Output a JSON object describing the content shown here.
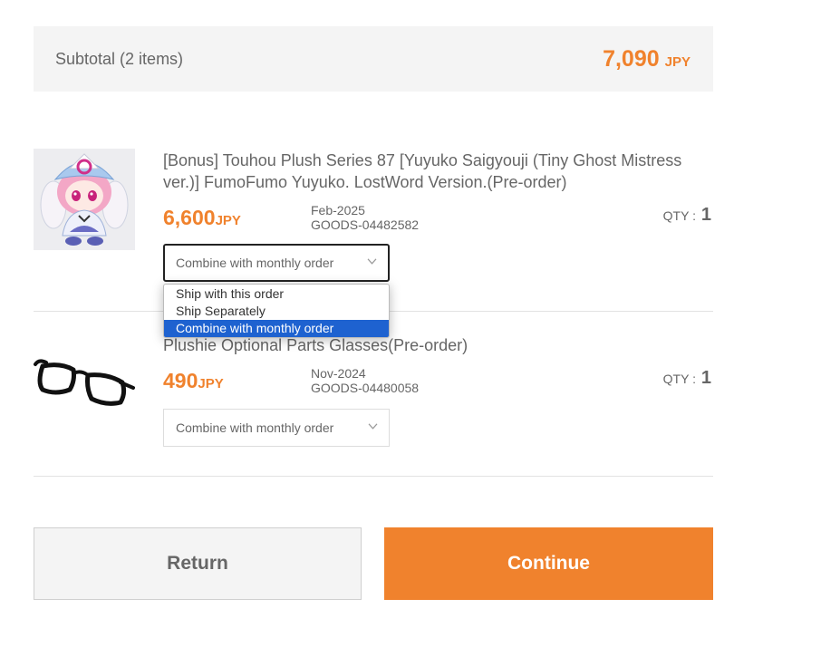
{
  "subtotal": {
    "label": "Subtotal (2 items)",
    "amount": "7,090",
    "currency": "JPY"
  },
  "items": [
    {
      "title": "[Bonus] Touhou Plush Series 87 [Yuyuko Saigyouji (Tiny Ghost Mistress ver.)] FumoFumo Yuyuko. LostWord Version.(Pre-order)",
      "price": "6,600",
      "currency": "JPY",
      "release": "Feb-2025",
      "code": "GOODS-04482582",
      "qty_label": "QTY : ",
      "qty": "1",
      "shipping_selected": "Combine with monthly order",
      "image": "yuyuko-plush-image"
    },
    {
      "title": "Plushie Optional Parts Glasses(Pre-order)",
      "price": "490",
      "currency": "JPY",
      "release": "Nov-2024",
      "code": "GOODS-04480058",
      "qty_label": "QTY : ",
      "qty": "1",
      "shipping_selected": "Combine with monthly order",
      "image": "glasses-image"
    }
  ],
  "shipping_options": [
    "Ship with this order",
    "Ship Separately",
    "Combine with monthly order"
  ],
  "buttons": {
    "return": "Return",
    "continue": "Continue"
  },
  "colors": {
    "accent": "#f0822d",
    "selected_option": "#1e62d0",
    "panel_bg": "#f4f4f4"
  },
  "icons": {
    "select_arrow": "chevron-down-icon"
  }
}
